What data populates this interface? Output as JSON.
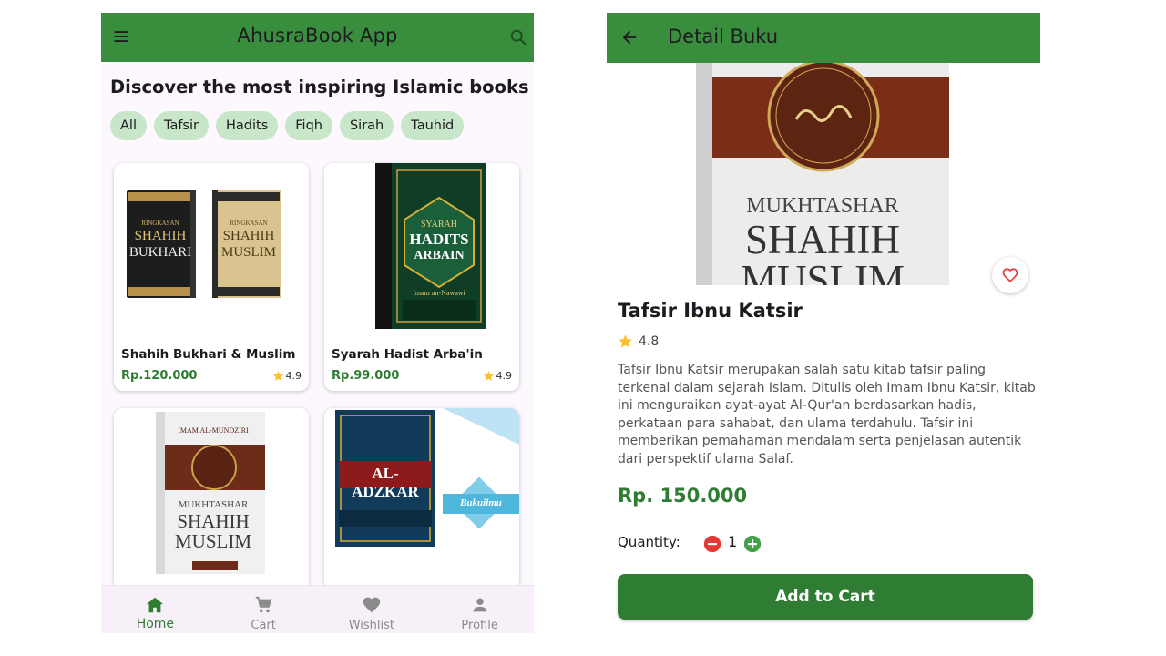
{
  "left": {
    "app_title": "AhusraBook App",
    "headline": "Discover the most inspiring Islamic books",
    "categories": [
      "All",
      "Tafsir",
      "Hadits",
      "Fiqh",
      "Sirah",
      "Tauhid"
    ],
    "books": [
      {
        "title": "Shahih Bukhari & Muslim",
        "price": "Rp.120.000",
        "rating": "4.9",
        "cover": {
          "left_top": "RINGKASAN",
          "left_main1": "SHAHIH",
          "left_main2": "BUKHARI",
          "right_top": "RINGKASAN",
          "right_main1": "SHAHIH",
          "right_main2": "MUSLIM"
        }
      },
      {
        "title": "Syarah Hadist Arba'in",
        "price": "Rp.99.000",
        "rating": "4.9",
        "cover": {
          "l1": "SYARAH",
          "l2": "HADITS",
          "l3": "ARBAIN",
          "author": "Imam an-Nawawi"
        }
      },
      {
        "title": "",
        "price": "",
        "rating": "",
        "cover": {
          "top": "IMAM AL-MUNDZIRI",
          "l1": "MUKHTASHAR",
          "l2": "SHAHIH",
          "l3": "MUSLIM"
        }
      },
      {
        "title": "",
        "price": "",
        "rating": "",
        "cover": {
          "l1": "AL-ADZKAR",
          "badge": "Bukuilmu"
        }
      }
    ],
    "nav": [
      {
        "label": "Home",
        "icon": "home-icon",
        "active": true
      },
      {
        "label": "Cart",
        "icon": "cart-icon",
        "active": false
      },
      {
        "label": "Wishlist",
        "icon": "heart-icon",
        "active": false
      },
      {
        "label": "Profile",
        "icon": "person-icon",
        "active": false
      }
    ]
  },
  "right": {
    "title": "Detail Buku",
    "cover": {
      "l1": "MUKHTASHAR",
      "l2": "SHAHIH",
      "l3": "MUSLIM"
    },
    "book_title": "Tafsir Ibnu Katsir",
    "rating": "4.8",
    "description": "Tafsir Ibnu Katsir merupakan salah satu kitab tafsir paling terkenal dalam sejarah Islam. Ditulis oleh Imam Ibnu Katsir, kitab ini menguraikan ayat-ayat Al-Qur'an berdasarkan hadis, perkataan para sahabat, dan ulama terdahulu. Tafsir ini memberikan pemahaman mendalam serta penjelasan autentik dari perspektif ulama Salaf.",
    "price": "Rp. 150.000",
    "quantity_label": "Quantity:",
    "quantity": "1",
    "add_to_cart": "Add to Cart"
  },
  "colors": {
    "primary": "#388e3c",
    "primary_dark": "#2e7d32",
    "chip": "#c8e6c9",
    "star": "#fbc02d",
    "minus": "#e53935",
    "plus": "#43a047",
    "favorite": "#e53935"
  }
}
